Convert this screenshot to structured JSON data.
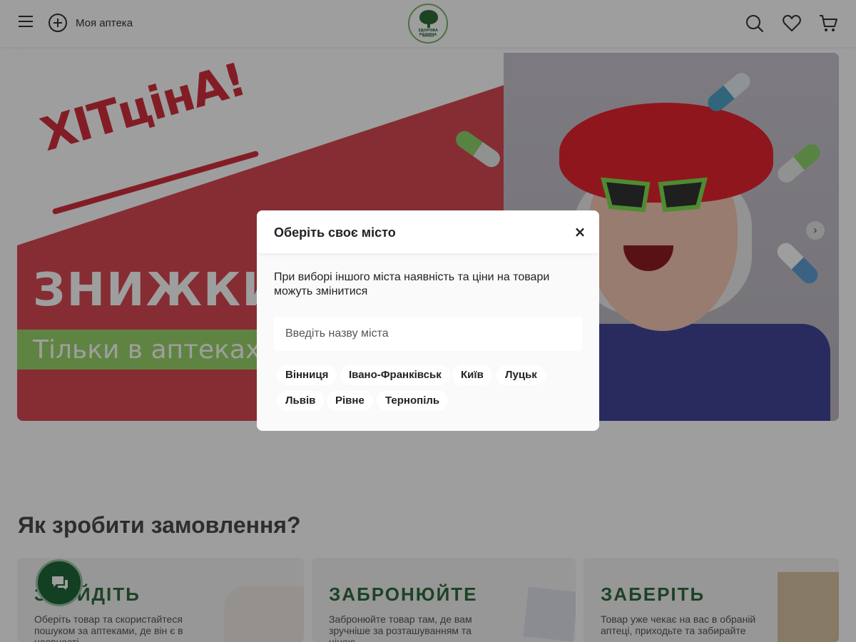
{
  "header": {
    "pharmacy_label": "Моя аптека",
    "logo_text": "ЗДОРОВА РОДИНА",
    "logo_sub": "Аптека",
    "icons": [
      "menu-icon",
      "plus-circle-icon",
      "search-icon",
      "heart-icon",
      "cart-icon"
    ]
  },
  "banner": {
    "brand": "ХІТцінА!",
    "title": "ЗНИЖКИ",
    "subtitle": "Тільки в аптеках \"",
    "next_icon": "›",
    "colors": {
      "red": "#d94a54",
      "green": "#9ad56b",
      "brand_red": "#d42f3d"
    }
  },
  "section": {
    "title": "Як зробити замовлення?",
    "steps": [
      {
        "title": "ЗНАЙДІТЬ",
        "text": "Оберіть товар та скористайтеся пошуком за аптеками, де він є в наявності"
      },
      {
        "title": "ЗАБРОНЮЙТЕ",
        "text": "Забронюйте товар там, де вам зручніше за розташуванням та ціною"
      },
      {
        "title": "ЗАБЕРІТЬ",
        "text": "Товар уже чекає на вас в обраній аптеці, приходьте та забирайте"
      }
    ]
  },
  "modal": {
    "title": "Оберіть своє місто",
    "close": "×",
    "note": "При виборі іншого міста наявність та ціни на товари можуть змінитися",
    "input_placeholder": "Введіть назву міста",
    "input_value": "",
    "cities": [
      "Вінниця",
      "Івано-Франківськ",
      "Київ",
      "Луцьк",
      "Львів",
      "Рівне",
      "Тернопіль"
    ]
  },
  "chat": {
    "icon": "chat-icon",
    "color": "#1f6637"
  }
}
